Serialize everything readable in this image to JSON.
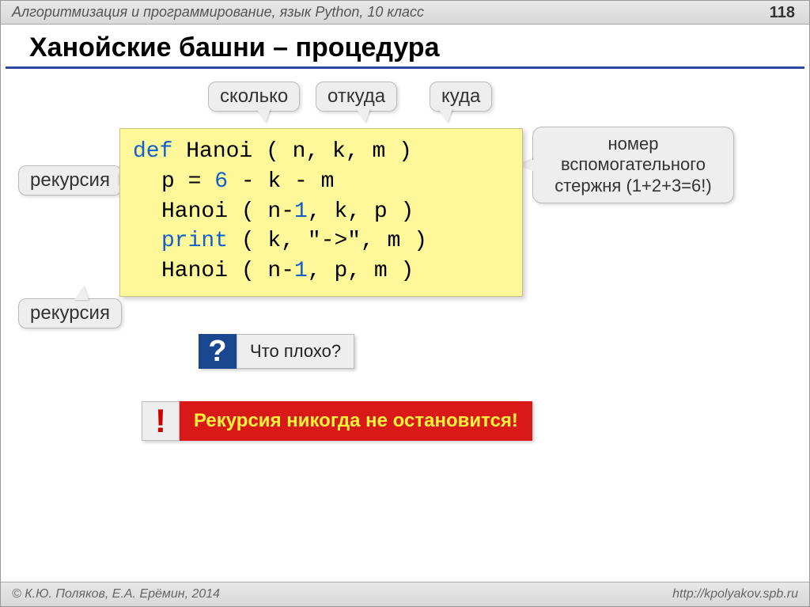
{
  "header": {
    "subject": "Алгоритмизация и программирование, язык Python, 10 класс",
    "page_number": "118"
  },
  "title": "Ханойские башни – процедура",
  "bubbles": {
    "howmany": "сколько",
    "from": "откуда",
    "to": "куда",
    "recursion1": "рекурсия",
    "recursion2": "рекурсия",
    "aux_rod": "номер вспомогательного стержня (1+2+3=6!)"
  },
  "code": {
    "def_kw": "def",
    "func_head": " Hanoi ( n, k, m )",
    "line2_a": "p = ",
    "line2_num": "6",
    "line2_b": " - k - m",
    "line3_a": "Hanoi ( n-",
    "line3_num": "1",
    "line3_b": ", k, p )",
    "print_kw": "print",
    "line4_b": " ( k, \"->\", m )",
    "line5_a": "Hanoi ( n-",
    "line5_num": "1",
    "line5_b": ", p, m )"
  },
  "question": {
    "mark": "?",
    "text": "Что плохо?"
  },
  "alert": {
    "mark": "!",
    "text": "Рекурсия никогда не остановится!"
  },
  "footer": {
    "copyright": "© К.Ю. Поляков, Е.А. Ерёмин, 2014",
    "url": "http://kpolyakov.spb.ru"
  }
}
